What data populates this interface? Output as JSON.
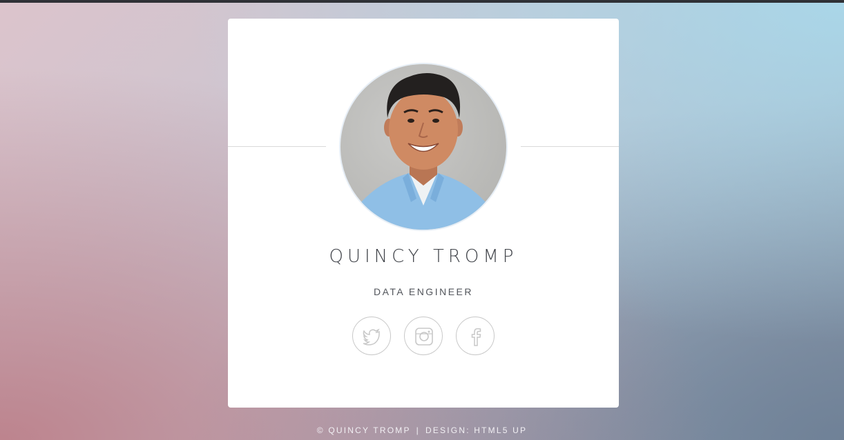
{
  "profile": {
    "name": "QUINCY TROMP",
    "role": "DATA ENGINEER"
  },
  "social": [
    {
      "icon": "twitter-icon",
      "label": "Twitter"
    },
    {
      "icon": "instagram-icon",
      "label": "Instagram"
    },
    {
      "icon": "facebook-icon",
      "label": "Facebook"
    }
  ],
  "footer": {
    "copyright": "© QUINCY TROMP",
    "separator": "|",
    "credit": "DESIGN: HTML5 UP"
  },
  "colors": {
    "card": "#ffffff",
    "text": "#3f4248",
    "icon_stroke": "#c8c8c8"
  }
}
